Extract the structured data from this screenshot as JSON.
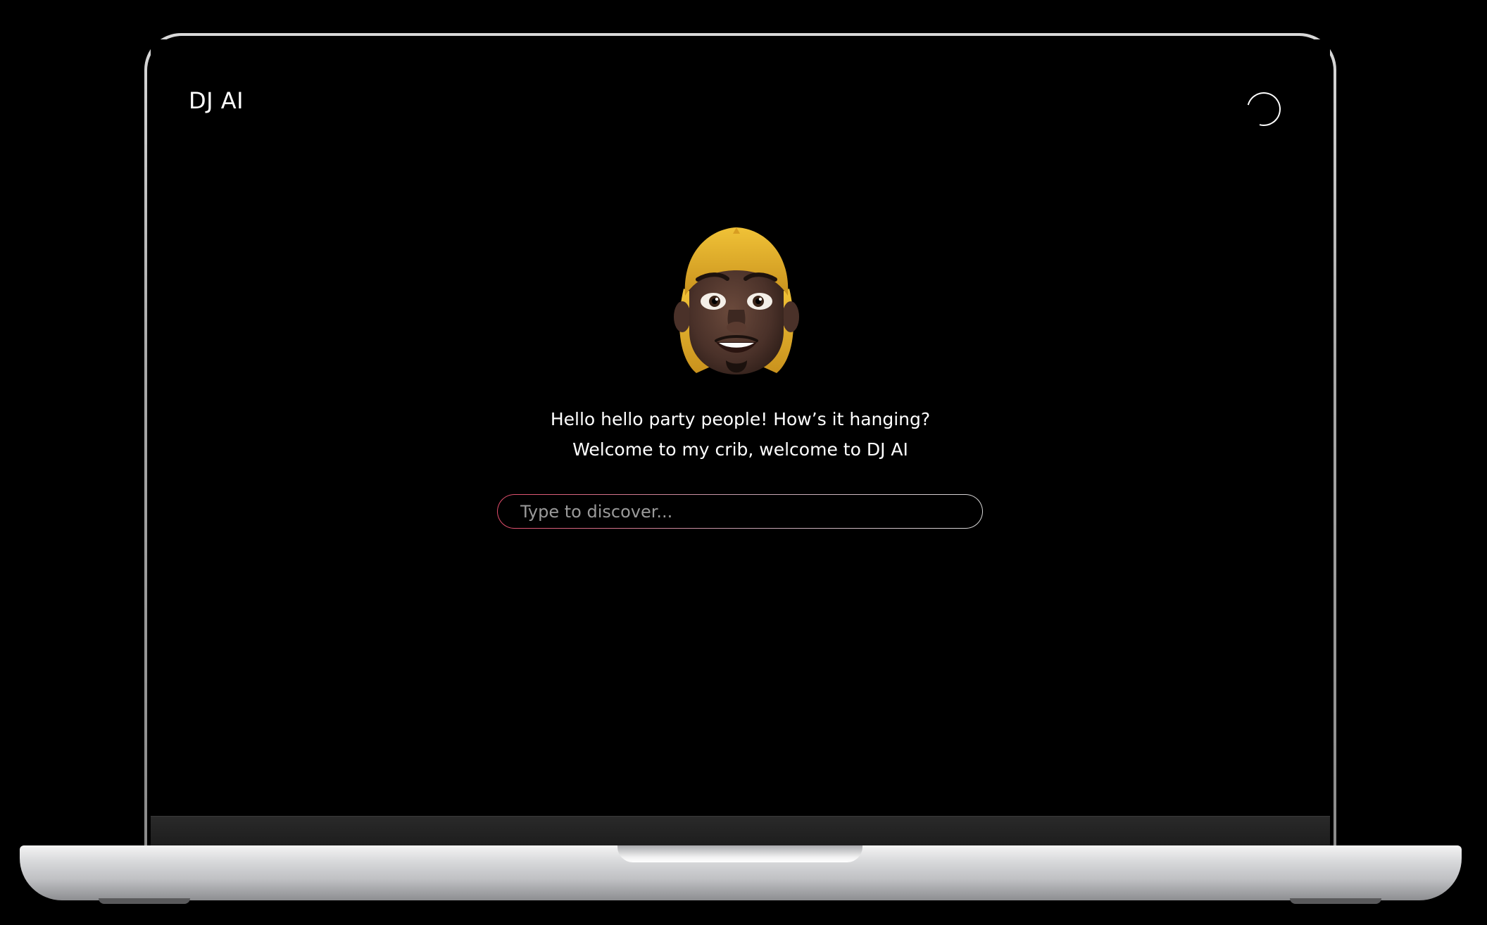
{
  "app": {
    "title": "DJ AI",
    "status_icon": "loading-spinner-icon"
  },
  "greeting": {
    "line1": "Hello hello party people! How’s it hanging?",
    "line2": "Welcome to my crib, welcome to DJ AI"
  },
  "avatar": {
    "icon": "memoji-avatar-icon"
  },
  "search": {
    "placeholder": "Type to discover...",
    "value": ""
  },
  "colors": {
    "background": "#000000",
    "text": "#ffffff",
    "accent": "#e14b6a",
    "placeholder": "#9a9a9a"
  }
}
